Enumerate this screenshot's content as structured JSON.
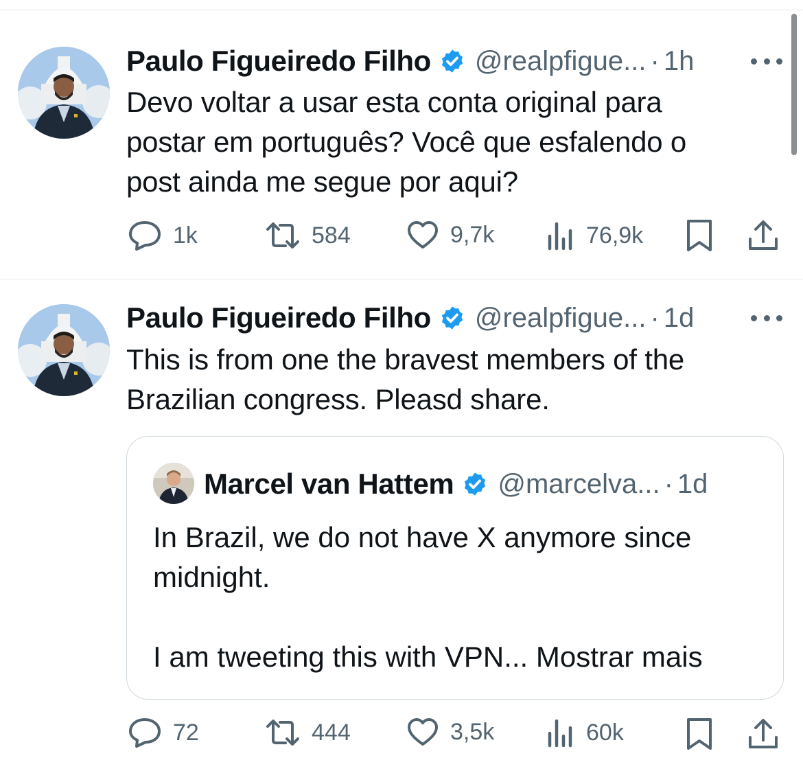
{
  "tweets": [
    {
      "author_name": "Paulo Figueiredo Filho",
      "handle": "@realpfigue...",
      "separator": "·",
      "time": "1h",
      "text_lines": [
        "Devo voltar a usar esta conta original para",
        "postar em português? Você que esfalendo o",
        "post ainda me segue por aqui?"
      ],
      "stats": {
        "replies": "1k",
        "reposts": "584",
        "likes": "9,7k",
        "views": "76,9k"
      }
    },
    {
      "author_name": "Paulo Figueiredo Filho",
      "handle": "@realpfigue...",
      "separator": "·",
      "time": "1d",
      "text_lines": [
        "This is from one the bravest members of the",
        "Brazilian congress. Pleasd share."
      ],
      "quote": {
        "author_name": "Marcel van Hattem",
        "handle": "@marcelva...",
        "separator": "·",
        "time": "1d",
        "text_lines": [
          "In Brazil, we do not have X anymore since",
          "midnight.",
          "",
          "I am tweeting this with VPN... Mostrar mais"
        ]
      },
      "stats": {
        "replies": "72",
        "reposts": "444",
        "likes": "3,5k",
        "views": "60k"
      }
    }
  ],
  "icons": {
    "verified": "verified-badge-icon",
    "more": "more-options-icon",
    "reply": "reply-icon",
    "repost": "repost-icon",
    "like": "like-icon",
    "views": "views-icon",
    "bookmark": "bookmark-icon",
    "share": "share-icon"
  },
  "colors": {
    "verified": "#1d9bf0",
    "text": "#0f1419",
    "muted": "#536471",
    "border": "#cfd9de"
  }
}
